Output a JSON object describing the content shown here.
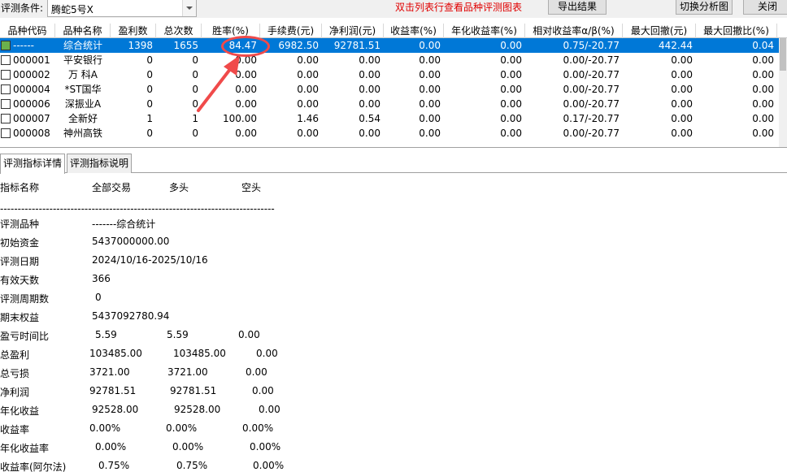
{
  "toolbar": {
    "condition_label": "评测条件:",
    "condition_value": "腾蛇5号X",
    "hint": "双击列表行查看品种评测图表",
    "export_label": "导出结果",
    "switch_label": "切换分析图",
    "close_label": "关闭"
  },
  "table": {
    "headers": [
      "品种代码",
      "品种名称",
      "盈利数",
      "总次数",
      "胜率(%)",
      "手续费(元)",
      "净利润(元)",
      "收益率(%)",
      "年化收益率(%)",
      "相对收益率α/β(%)",
      "最大回撤(元)",
      "最大回撤比(%)"
    ],
    "rows": [
      [
        "------",
        "综合统计",
        "1398",
        "1655",
        "84.47",
        "6982.50",
        "92781.51",
        "0.00",
        "0.00",
        "0.75/-20.77",
        "442.44",
        "0.04"
      ],
      [
        "000001",
        "平安银行",
        "0",
        "0",
        "0.00",
        "0.00",
        "0.00",
        "0.00",
        "0.00",
        "0.00/-20.77",
        "0.00",
        "0.00"
      ],
      [
        "000002",
        "万 科A",
        "0",
        "0",
        "0.00",
        "0.00",
        "0.00",
        "0.00",
        "0.00",
        "0.00/-20.77",
        "0.00",
        "0.00"
      ],
      [
        "000004",
        "*ST国华",
        "0",
        "0",
        "0.00",
        "0.00",
        "0.00",
        "0.00",
        "0.00",
        "0.00/-20.77",
        "0.00",
        "0.00"
      ],
      [
        "000006",
        "深振业A",
        "0",
        "0",
        "0.00",
        "0.00",
        "0.00",
        "0.00",
        "0.00",
        "0.00/-20.77",
        "0.00",
        "0.00"
      ],
      [
        "000007",
        "全新好",
        "1",
        "1",
        "100.00",
        "1.46",
        "0.54",
        "0.00",
        "0.00",
        "0.17/-20.77",
        "0.00",
        "0.00"
      ],
      [
        "000008",
        "神州高铁",
        "0",
        "0",
        "0.00",
        "0.00",
        "0.00",
        "0.00",
        "0.00",
        "0.00/-20.77",
        "0.00",
        "0.00"
      ]
    ]
  },
  "tabs": [
    "评测指标详情",
    "评测指标说明"
  ],
  "detail": {
    "header": [
      "指标名称",
      "全部交易",
      "多头",
      "空头"
    ],
    "dashes": "------------------------------------------------------------------------------",
    "rows": [
      {
        "name": "评测品种",
        "all": "-------综合统计",
        "long": "",
        "short": ""
      },
      {
        "name": "初始资金",
        "all": "5437000000.00",
        "long": "",
        "short": ""
      },
      {
        "name": "评测日期",
        "all": "2024/10/16-2025/10/16",
        "long": "",
        "short": ""
      },
      {
        "name": "有效天数",
        "all": "366",
        "long": "",
        "short": ""
      },
      {
        "name": "评测周期数",
        "all": "0",
        "long": "",
        "short": ""
      },
      {
        "name": "期末权益",
        "all": "5437092780.94",
        "long": "",
        "short": ""
      },
      {
        "name": "盈亏时间比",
        "all": "5.59",
        "long": "5.59",
        "short": "0.00"
      },
      {
        "name": "总盈利",
        "all": "103485.00",
        "long": "103485.00",
        "short": "0.00"
      },
      {
        "name": "总亏损",
        "all": "3721.00",
        "long": "3721.00",
        "short": "0.00"
      },
      {
        "name": "净利润",
        "all": "92781.51",
        "long": "92781.51",
        "short": "0.00"
      },
      {
        "name": "年化收益",
        "all": "92528.00",
        "long": "92528.00",
        "short": "0.00"
      },
      {
        "name": "收益率",
        "all": "0.00%",
        "long": "0.00%",
        "short": "0.00%"
      },
      {
        "name": "年化收益率",
        "all": "0.00%",
        "long": "0.00%",
        "short": "0.00%"
      },
      {
        "name": "收益率(阿尔法)",
        "all": "0.75%",
        "long": "0.75%",
        "short": "0.00%"
      }
    ]
  },
  "colors": {
    "selected_row": "#0078d7",
    "hint_text": "#e00000",
    "annotation": "#f04a4a"
  }
}
